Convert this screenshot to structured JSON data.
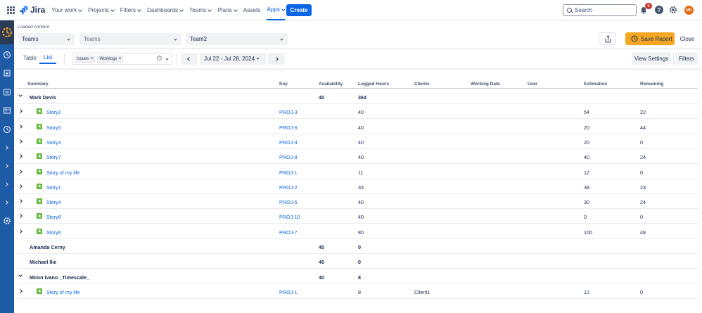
{
  "nav": {
    "brand": "Jira",
    "items": [
      {
        "label": "Your work",
        "chev": true
      },
      {
        "label": "Projects",
        "chev": true
      },
      {
        "label": "Filters",
        "chev": true
      },
      {
        "label": "Dashboards",
        "chev": true
      },
      {
        "label": "Teams",
        "chev": true
      },
      {
        "label": "Plans",
        "chev": true
      },
      {
        "label": "Assets",
        "chev": false
      },
      {
        "label": "Apps",
        "chev": true,
        "active": true
      }
    ],
    "create_label": "Create",
    "search_placeholder": "Search",
    "notifications_count": "6",
    "help_label": "?",
    "avatar_initials": "MD"
  },
  "report": {
    "loaded_label": "Loaded content",
    "select1": "Teams",
    "select2_placeholder": "Teams",
    "select3": "Team2",
    "save_label": "Save Report",
    "close_label": "Close"
  },
  "toolbar": {
    "tab_table": "Table",
    "tab_list": "List",
    "chip1": "Issues",
    "chip2": "Worklogs",
    "date_range": "Jul 22 - Jul 28, 2024",
    "view_settings": "View Settings",
    "filters": "Filters"
  },
  "table": {
    "headers": [
      "Summary",
      "Key",
      "Availability",
      "Logged Hours",
      "Clients",
      "Worklog Date",
      "User",
      "Estimation",
      "Remaining"
    ],
    "rows": [
      {
        "type": "group",
        "expanded": true,
        "summary": "Mark Devis",
        "availability": "40",
        "logged": "364"
      },
      {
        "type": "issue",
        "summary": "Story2",
        "key": "PROJ-3",
        "logged": "40",
        "estimation": "54",
        "remaining": "22"
      },
      {
        "type": "issue",
        "summary": "Story5",
        "key": "PROJ-6",
        "logged": "40",
        "estimation": "20",
        "remaining": "44"
      },
      {
        "type": "issue",
        "summary": "Story3",
        "key": "PROJ-4",
        "logged": "40",
        "estimation": "20",
        "remaining": "0"
      },
      {
        "type": "issue",
        "summary": "Story7",
        "key": "PROJ-8",
        "logged": "40",
        "estimation": "40",
        "remaining": "24"
      },
      {
        "type": "issue",
        "summary": "Story of my life",
        "key": "PROJ-1",
        "logged": "11",
        "estimation": "12",
        "remaining": "0"
      },
      {
        "type": "issue",
        "summary": "Story1",
        "key": "PROJ-2",
        "logged": "33",
        "estimation": "38",
        "remaining": "23"
      },
      {
        "type": "issue",
        "summary": "Story4",
        "key": "PROJ-5",
        "logged": "40",
        "estimation": "30",
        "remaining": "24"
      },
      {
        "type": "issue",
        "summary": "Story8",
        "key": "PROJ-10",
        "logged": "40",
        "estimation": "0",
        "remaining": "0"
      },
      {
        "type": "issue",
        "summary": "Story6",
        "key": "PROJ-7",
        "logged": "80",
        "estimation": "100",
        "remaining": "48"
      },
      {
        "type": "group",
        "expanded": null,
        "summary": "Amanda Cerny",
        "availability": "40",
        "logged": "0"
      },
      {
        "type": "group",
        "expanded": null,
        "summary": "Michael Ilie",
        "availability": "40",
        "logged": "0"
      },
      {
        "type": "group",
        "expanded": true,
        "summary": "Miron Ivano _Timescale_",
        "availability": "40",
        "logged": "8"
      },
      {
        "type": "issue",
        "summary": "Story of my life",
        "key": "PROJ-1",
        "logged": "8",
        "client": "Client1",
        "estimation": "12",
        "remaining": "0"
      }
    ]
  },
  "colors": {
    "accent": "#0c66e4",
    "save": "#f5a623",
    "sidebar": "#1d5ba7",
    "story": "#63ba3c"
  }
}
